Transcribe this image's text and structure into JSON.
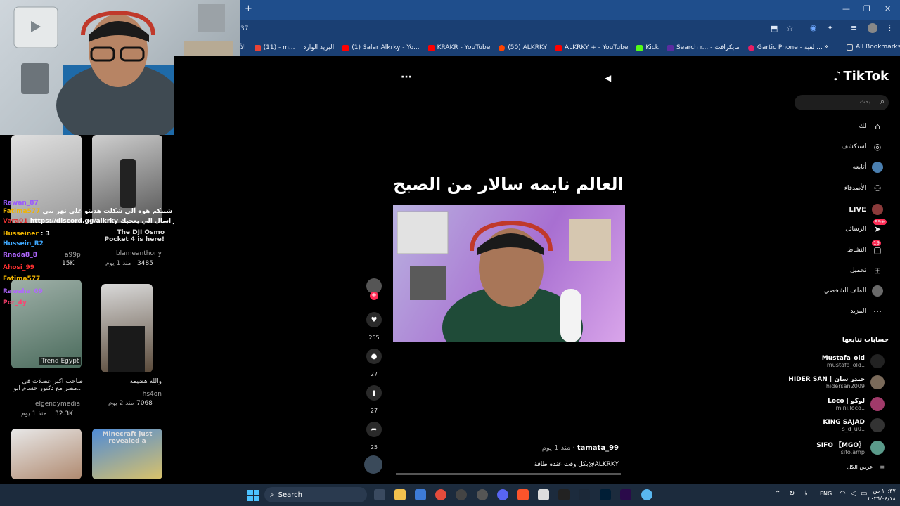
{
  "browser": {
    "address_fragment": "37",
    "bookmarks": [
      {
        "label": "الأ",
        "color": "#f2f2f2"
      },
      {
        "label": "(11) - m...",
        "color": "#ea4335"
      },
      {
        "label": "البريد الوارد",
        "color": "#ea4335"
      },
      {
        "label": "(1) Salar Alkrky - Yo...",
        "color": "#ff0000"
      },
      {
        "label": "KRAKR - YouTube",
        "color": "#ff0000"
      },
      {
        "label": "(50) ALKRKY",
        "color": "#ff4500"
      },
      {
        "label": "ALKRKY + - YouTube",
        "color": "#ff0000"
      },
      {
        "label": "Kick",
        "color": "#53fc18"
      },
      {
        "label": "Search r... - مايكرافت",
        "color": "#5b2ca0"
      },
      {
        "label": "Gartic Phone - لعبة ...",
        "color": "#e91e63"
      }
    ],
    "all_bookmarks": "All Bookmarks",
    "window_controls": [
      "—",
      "❐",
      "✕"
    ],
    "new_tab": "+"
  },
  "left": {
    "videos": [
      {
        "caption": "",
        "handle": "",
        "meta": "",
        "likes": ""
      },
      {
        "caption": "The DJI Osmo Pocket 4 is here!",
        "handle": "blameanthony",
        "meta": "منذ 1 يوم",
        "likes": "3485"
      },
      {
        "caption": "صاحب اكبر عضلات في مصر مع دكتور حسام ابو...",
        "handle": "elgendymedia",
        "meta": "منذ 1 يوم",
        "likes": "32.3K"
      },
      {
        "caption": "والله هضيمه",
        "handle": "hs4on",
        "meta": "منذ 2 يوم",
        "likes": "7068"
      },
      {
        "caption": "",
        "handle": "",
        "meta": "",
        "likes": ""
      },
      {
        "caption": "Minecraft just revealed a",
        "handle": "",
        "meta": "",
        "likes": ""
      }
    ],
    "first_video_likes": "15K",
    "first_video_handle": "a99p",
    "trend_badge": "Trend Egypt",
    "chat": [
      {
        "user": "Rawan_87",
        "msg": "",
        "color": "#9b59ff"
      },
      {
        "user": "Fatima577",
        "msg": "شبيكم هوه الي شكلت هديتو على نهر ببي",
        "color": "#f0b400"
      },
      {
        "user": "Vara01",
        "msg": "https://discord.gg/alkrky افتح تكت هنا : و روح تكت و اختار كيك و اسال الي يعجبك",
        "color": "#e03030"
      },
      {
        "user": "Husseiner",
        "msg": "3",
        "color": "#f0b400"
      },
      {
        "user": "Hussein_R2",
        "msg": "",
        "color": "#3fa9ff"
      },
      {
        "user": "Rnada8_8",
        "msg": "",
        "color": "#b066ff"
      },
      {
        "user": "Ahosi_99",
        "msg": "",
        "color": "#ff3030"
      },
      {
        "user": "Fatima577",
        "msg": "",
        "color": "#f0b400"
      },
      {
        "user": "Rawaha_09",
        "msg": "",
        "color": "#b066ff"
      },
      {
        "user": "Por_4y",
        "msg": "",
        "color": "#ff4070"
      }
    ]
  },
  "tiktok": {
    "logo": "TikTok",
    "search_placeholder": "بحث",
    "nav": [
      {
        "label": "لك",
        "icon": "home-icon",
        "glyph": "⌂"
      },
      {
        "label": "استكشف",
        "icon": "compass-icon",
        "glyph": "◎"
      },
      {
        "label": "أتابعه",
        "icon": "following-avatar-icon",
        "glyph": ""
      },
      {
        "label": "الأصدقاء",
        "icon": "friends-icon",
        "glyph": "⚇"
      },
      {
        "label": "LIVE",
        "icon": "live-icon",
        "glyph": ""
      },
      {
        "label": "الرسائل",
        "icon": "messages-icon",
        "glyph": "➤",
        "badge": "99+"
      },
      {
        "label": "النشاط",
        "icon": "activity-icon",
        "glyph": "▢",
        "badge": "19"
      },
      {
        "label": "تحميل",
        "icon": "upload-icon",
        "glyph": "⊞"
      },
      {
        "label": "الملف الشخصي",
        "icon": "profile-icon",
        "glyph": ""
      },
      {
        "label": "المزيد",
        "icon": "more-icon",
        "glyph": "⋯"
      }
    ],
    "following_title": "حسابات تتابعها",
    "following": [
      {
        "name": "Mustafa_old",
        "handle": "mustafa_old1"
      },
      {
        "name": "HIDER SAN | حيدر سان",
        "handle": "hidersan2009"
      },
      {
        "name": "Loco | لوكو",
        "handle": "mini.loco1"
      },
      {
        "name": "KING SAJAD",
        "handle": "s_d_u01"
      },
      {
        "name": "SIFO 〖MGO〗",
        "handle": "sifo.amp"
      }
    ],
    "show_all": "عرض الكل",
    "video": {
      "title": "العالم نايمه سالار من الصبح",
      "author": "tamata_99",
      "time": "منذ 1 يوم",
      "description": "بكل وقت عنده طاقة@ALKRKY",
      "likes": "255",
      "comments": "27",
      "saves": "27",
      "shares": "25",
      "menu_dots": "···"
    }
  },
  "taskbar": {
    "search": "Search",
    "lang": "ENG",
    "time": "١٠:٣٧ ص",
    "date": "٢٠٢٦/٠٤/١٨"
  }
}
